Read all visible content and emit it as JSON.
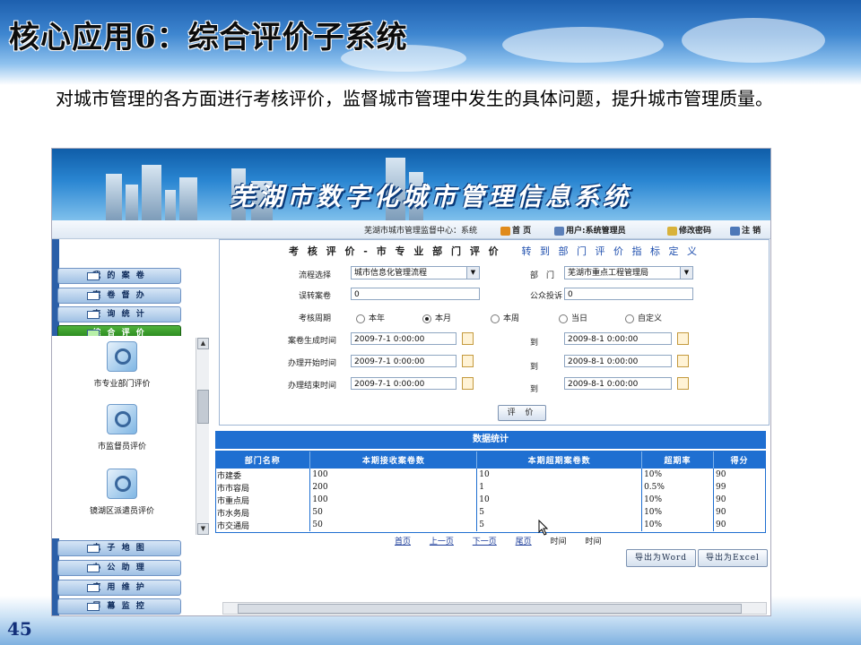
{
  "slide": {
    "title": "核心应用6：综合评价子系统",
    "description": "对城市管理的各方面进行考核评价，监督城市管理中发生的具体问题，提升城市管理质量。",
    "page_number": "45"
  },
  "app": {
    "banner_title": "芜湖市数字化城市管理信息系统",
    "topbar": {
      "center": "芜湖市城市管理监督中心：系统",
      "home": "首 页",
      "user": "用户:系统管理员",
      "change_password": "修改密码",
      "logout": "注 销"
    },
    "sidebar": {
      "top_items": [
        "我 的 案 卷",
        "案 卷 督 办",
        "查 询 统 计",
        "综 合 评 价"
      ],
      "active_index": 3,
      "tools": [
        "市专业部门评价",
        "市监督员评价",
        "镜湖区派遣员评价"
      ],
      "bottom_items": [
        "电 子 地 图",
        "办 公 助 理",
        "应 用 维 护",
        "屏 幕 监 控"
      ]
    },
    "form": {
      "heading": "考 核 评 价 - 市 专 业 部 门 评 价",
      "heading_link": "转 到 部 门 评 价 指 标 定 义",
      "process_label": "流程选择",
      "process_value": "城市信息化管理流程",
      "dept_label": "部　门",
      "dept_value": "芜湖市重点工程管理局",
      "misrouted_label": "误转案卷",
      "misrouted_value": "0",
      "complaint_label": "公众投诉",
      "complaint_value": "0",
      "period_label": "考核周期",
      "period_options": [
        "本年",
        "本月",
        "本周",
        "当日",
        "自定义"
      ],
      "period_selected": 1,
      "rows": [
        {
          "label": "案卷生成时间",
          "from": "2009-7-1 0:00:00",
          "to_label": "到",
          "to": "2009-8-1 0:00:00"
        },
        {
          "label": "办理开始时间",
          "from": "2009-7-1 0:00:00",
          "to_label": "到",
          "to": "2009-8-1 0:00:00"
        },
        {
          "label": "办理结束时间",
          "from": "2009-7-1 0:00:00",
          "to_label": "到",
          "to": "2009-8-1 0:00:00"
        }
      ],
      "submit_label": "评 价"
    },
    "stats": {
      "title": "数据统计",
      "columns": [
        "部门名称",
        "本期接收案卷数",
        "本期超期案卷数",
        "超期率",
        "得分"
      ],
      "rows": [
        [
          "市建委",
          "100",
          "10",
          "10%",
          "90"
        ],
        [
          "市市容局",
          "200",
          "1",
          "0.5%",
          "99"
        ],
        [
          "市重点局",
          "100",
          "10",
          "10%",
          "90"
        ],
        [
          "市水务局",
          "50",
          "5",
          "10%",
          "90"
        ],
        [
          "市交通局",
          "50",
          "5",
          "10%",
          "90"
        ]
      ],
      "pager": [
        "首页",
        "上一页",
        "下一页",
        "尾页",
        "时间",
        "时间"
      ],
      "export_word": "导出为Word",
      "export_excel": "导出为Excel"
    }
  },
  "colors": {
    "accent_blue": "#1f6fd1",
    "active_green": "#2f9a22",
    "link_blue": "#1f4fae"
  }
}
